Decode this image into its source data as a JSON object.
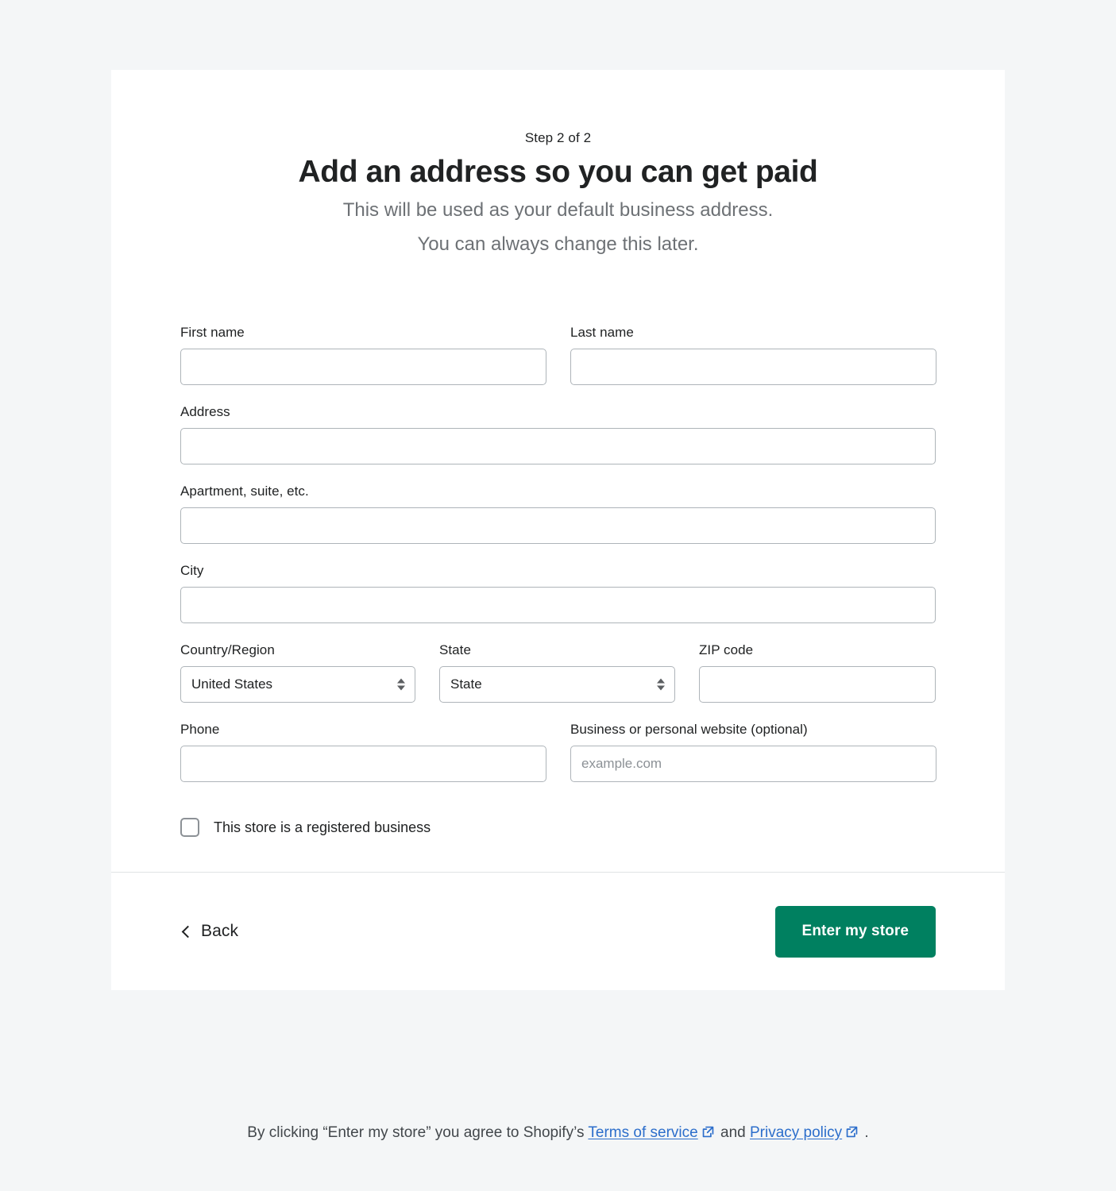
{
  "header": {
    "step_label": "Step 2 of 2",
    "title": "Add an address so you can get paid",
    "subtitle_line1": "This will be used as your default business address.",
    "subtitle_line2": "You can always change this later."
  },
  "form": {
    "first_name": {
      "label": "First name",
      "value": "",
      "placeholder": ""
    },
    "last_name": {
      "label": "Last name",
      "value": "",
      "placeholder": ""
    },
    "address": {
      "label": "Address",
      "value": "",
      "placeholder": ""
    },
    "apartment": {
      "label": "Apartment, suite, etc.",
      "value": "",
      "placeholder": ""
    },
    "city": {
      "label": "City",
      "value": "",
      "placeholder": ""
    },
    "country": {
      "label": "Country/Region",
      "selected": "United States"
    },
    "state": {
      "label": "State",
      "selected": "State"
    },
    "zip": {
      "label": "ZIP code",
      "value": "",
      "placeholder": ""
    },
    "phone": {
      "label": "Phone",
      "value": "",
      "placeholder": ""
    },
    "website": {
      "label": "Business or personal website (optional)",
      "value": "",
      "placeholder": "example.com"
    },
    "registered_business": {
      "label": "This store is a registered business",
      "checked": false
    }
  },
  "footer": {
    "back_label": "Back",
    "submit_label": "Enter my store"
  },
  "legal": {
    "prefix": "By clicking “Enter my store” you agree to Shopify’s",
    "terms_link": "Terms of service",
    "conjunction": "and",
    "privacy_link": "Privacy policy",
    "suffix": "."
  },
  "colors": {
    "accent_green": "#008060",
    "link_blue": "#2c6ecb",
    "page_bg": "#f4f6f7",
    "card_bg": "#ffffff",
    "border": "#aeb4b9",
    "muted_text": "#6d7175"
  }
}
